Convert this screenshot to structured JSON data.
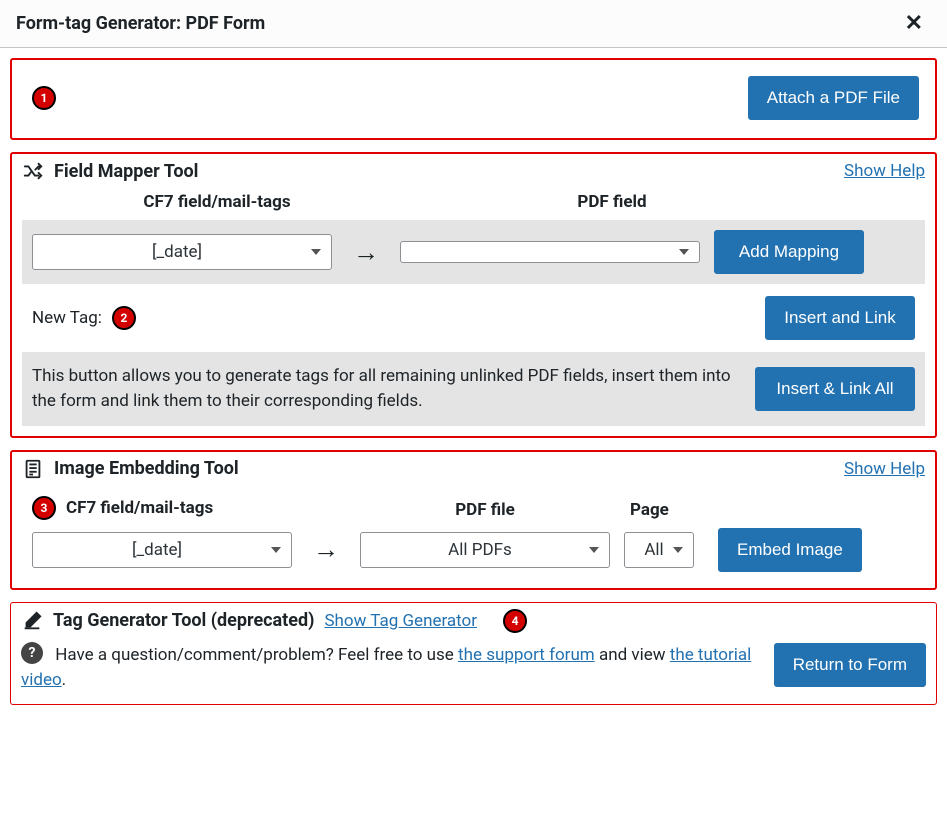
{
  "dialog": {
    "title": "Form-tag Generator: PDF Form",
    "close_icon": "✕"
  },
  "attach": {
    "button": "Attach a PDF File",
    "annotation": "1"
  },
  "mapper": {
    "title": "Field Mapper Tool",
    "help_link": "Show Help",
    "col_cf7": "CF7 field/mail-tags",
    "col_pdf": "PDF field",
    "cf7_select": "[_date]",
    "pdf_select": "",
    "add_button": "Add Mapping",
    "new_tag_label": "New Tag:",
    "new_tag_annotation": "2",
    "insert_link_button": "Insert and Link",
    "linkall_text": "This button allows you to generate tags for all remaining unlinked PDF fields, insert them into the form and link them to their corresponding fields.",
    "linkall_button": "Insert & Link All"
  },
  "embed": {
    "title": "Image Embedding Tool",
    "help_link": "Show Help",
    "annotation": "3",
    "col_cf7": "CF7 field/mail-tags",
    "col_pdf": "PDF file",
    "col_page": "Page",
    "cf7_select": "[_date]",
    "pdf_select": "All PDFs",
    "page_select": "All",
    "button": "Embed Image"
  },
  "taggen": {
    "title": "Tag Generator Tool (deprecated)",
    "link": "Show Tag Generator",
    "annotation": "4",
    "help_prefix": "Have a question/comment/problem? Feel free to use ",
    "support_link": "the support forum",
    "help_mid": " and view ",
    "tutorial_link": "the tutorial video",
    "help_suffix": ".",
    "return_button": "Return to Form"
  }
}
